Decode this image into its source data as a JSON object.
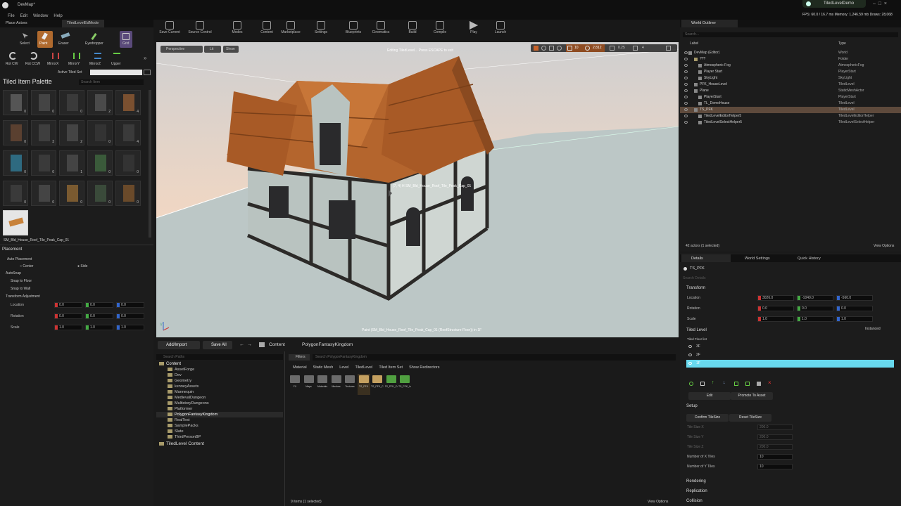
{
  "title": {
    "app": "DevMap*",
    "project": "TiledLevelDemo"
  },
  "menu": [
    "File",
    "Edit",
    "Window",
    "Help"
  ],
  "perf": "FPS: 60.0 / 16.7 ms  Memory: 1,246.59 mb  Draws: 28,068",
  "panel_tabs": {
    "place_actors": "Place Actors",
    "mode": "TiledLevelEdMode"
  },
  "tools": {
    "row1": [
      "Select",
      "Paint",
      "Eraser",
      "Eyedropper",
      "Grid"
    ],
    "row2": [
      "Rot CW",
      "Rot CCW",
      "MirrorX",
      "MirrorY",
      "MirrorZ",
      "Upper"
    ],
    "active_set_label": "Active Tiled Set",
    "search": "Search Item"
  },
  "palette": {
    "title": "Tiled Item Palette",
    "selected_item": "SM_Bld_House_Roof_Tile_Peak_Cap_01",
    "counts": [
      "0",
      "0",
      "0",
      "2",
      "4",
      "0",
      "3",
      "2",
      "0",
      "4",
      "0",
      "0",
      "1",
      "0",
      "0",
      "0",
      "0",
      "0",
      "0",
      "0",
      "0",
      "0",
      "0",
      "0",
      "0"
    ]
  },
  "placement": {
    "title": "Placement",
    "auto_placement": "Auto Placement",
    "center": "Center",
    "side": "Side",
    "autosnap": "AutoSnap",
    "snap_floor": "Snap to Floor",
    "snap_wall": "Snap to Wall",
    "transform_adjustment": "Transform Adjustment",
    "rows": [
      {
        "label": "Location",
        "x": "0.0",
        "y": "0.0",
        "z": "0.0"
      },
      {
        "label": "Rotation",
        "x": "0.0",
        "y": "0.0",
        "z": "0.0"
      },
      {
        "label": "Scale",
        "x": "1.0",
        "y": "1.0",
        "z": "1.0"
      }
    ]
  },
  "toolbar": [
    "Save Current",
    "Source Control",
    "Modes",
    "Content",
    "Marketplace",
    "Settings",
    "Blueprints",
    "Cinematics",
    "Build",
    "Compile",
    "Play",
    "Launch"
  ],
  "viewport": {
    "perspective": "Perspective",
    "lit": "Lit",
    "show": "Show",
    "editing_msg": "Editing TiledLevel... Press ESCAPE to exit",
    "tile_label": "(7, 4) H SM_Bld_House_Roof_Tile_Peak_Cap_01",
    "paint_msg": "Paint (SM_Bld_House_Roof_Tile_Peak_Cap_01 (RoofStructure Floor)) in 1F",
    "snap_values": [
      "10",
      "2.812",
      "0.25",
      "4"
    ]
  },
  "content": {
    "add_import": "Add/Import",
    "save_all": "Save All",
    "crumb_root": "Content",
    "crumb_folder": "PolygonFantasyKingdom",
    "search_paths": "Search Paths",
    "filters": "Filters",
    "search_assets": "Search PolygonFantasyKingdom",
    "tree": [
      "Content",
      "AssetForge",
      "Dev",
      "Geometry",
      "kenneyAssets",
      "Mannequin",
      "MedievalDungeon",
      "MultistoryDungeons",
      "Platformer",
      "PolygonFantasyKingdom",
      "RealTest",
      "SamplePacks",
      "Slate",
      "ThirdPersonBP"
    ],
    "tree_footer": "TiledLevel Content",
    "filter_tabs": [
      "Material",
      "Static Mesh",
      "Level",
      "TiledLevel",
      "Tiled Item Set",
      "Show Redirectors"
    ],
    "assets": [
      "FX",
      "Maps",
      "Materials",
      "Meshes",
      "Textures",
      "TS_PFK",
      "TS_PFK_Castle",
      "TS_PFK_Castle_Level",
      "TS_PFK_Level"
    ],
    "status": "9 items (1 selected)",
    "view_options": "View Options"
  },
  "outliner": {
    "tab": "World Outliner",
    "search": "Search...",
    "col_label": "Label",
    "col_type": "Type",
    "rows": [
      {
        "label": "DevMap (Editor)",
        "type": "World"
      },
      {
        "label": "???",
        "type": "Folder"
      },
      {
        "label": "Atmospheric Fog",
        "type": "AtmosphericFog"
      },
      {
        "label": "Player Start",
        "type": "PlayerStart"
      },
      {
        "label": "SkyLight",
        "type": "SkyLight"
      },
      {
        "label": "PFK_HouseLevel",
        "type": "TiledLevel"
      },
      {
        "label": "Plane",
        "type": "StaticMeshActor"
      },
      {
        "label": "PlayerStart",
        "type": "PlayerStart"
      },
      {
        "label": "TL_DemoHouse",
        "type": "TiledLevel"
      },
      {
        "label": "TS_PFK",
        "type": "TiledLevel"
      },
      {
        "label": "TiledLevelEditorHelper5",
        "type": "TiledLevelEditorHelper"
      },
      {
        "label": "TiledLevelSelectHelper5",
        "type": "TiledLevelSelectHelper"
      }
    ],
    "count": "42 actors (1 selected)",
    "view_options": "View Options"
  },
  "details": {
    "tabs": [
      "Details",
      "World Settings",
      "Quick History"
    ],
    "selected": "TS_PFK",
    "search": "Search Details",
    "transform": "Transform",
    "rows": [
      {
        "label": "Location",
        "x": "3026.0",
        "y": "-1040.0",
        "z": "-560.0"
      },
      {
        "label": "Rotation",
        "x": "0.0",
        "y": "0.0",
        "z": "0.0"
      },
      {
        "label": "Scale",
        "x": "1.0",
        "y": "1.0",
        "z": "1.0"
      }
    ],
    "tiled_level": "Tiled Level",
    "instanced": "Instanced",
    "floor_list": "Tiled Floor list",
    "floors": [
      "3F",
      "2F",
      "1F"
    ],
    "edit": "Edit",
    "promote": "Promote To Asset",
    "setup": "Setup",
    "confirm": "Confirm TileSize",
    "reset": "Reset TileSize",
    "tile_rows": [
      {
        "label": "Tile Size X",
        "value": "200.0"
      },
      {
        "label": "Tile Size Y",
        "value": "200.0"
      },
      {
        "label": "Tile Size Z",
        "value": "200.0"
      },
      {
        "label": "Number of X Tiles",
        "value": "10"
      },
      {
        "label": "Number of Y Tiles",
        "value": "10"
      }
    ],
    "sections": [
      "Rendering",
      "Replication",
      "Collision"
    ]
  }
}
